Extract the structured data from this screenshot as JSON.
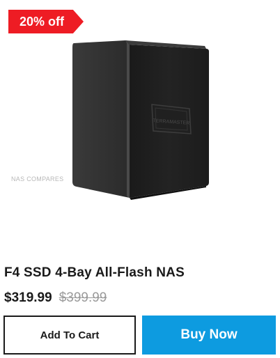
{
  "product": {
    "badge": "20% off",
    "watermark": "NAS COMPARES",
    "logo_text": "TERRAMASTER",
    "title": "F4 SSD 4-Bay All-Flash NAS",
    "price": "$319.99",
    "original_price": "$399.99"
  },
  "actions": {
    "add_to_cart_label": "Add To Cart",
    "buy_now_label": "Buy Now"
  },
  "colors": {
    "badge": "#ee1c24",
    "buy_button": "#0d9be0",
    "text": "#1a1a1a",
    "strike_price": "#9a9a9a"
  },
  "icons": {
    "product": "nas-device-image"
  }
}
